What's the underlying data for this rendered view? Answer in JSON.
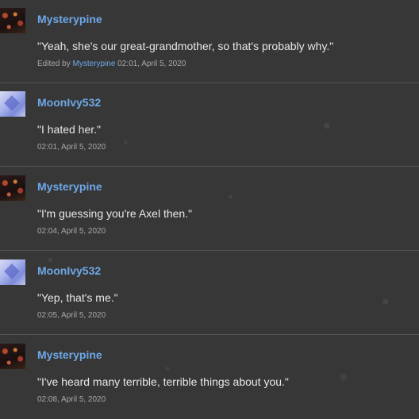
{
  "comments": [
    {
      "author": "Mysterypine",
      "avatar": "mysterypine-avatar",
      "text": "\"Yeah, she's our great-grandmother, so that's probably why.\"",
      "edited_prefix": "Edited by",
      "edited_by": "Mysterypine",
      "timestamp": "02:01, April 5, 2020"
    },
    {
      "author": "MoonIvy532",
      "avatar": "moonivy532-avatar",
      "text": "\"I hated her.\"",
      "timestamp": "02:01, April 5, 2020"
    },
    {
      "author": "Mysterypine",
      "avatar": "mysterypine-avatar",
      "text": "\"I'm guessing you're Axel then.\"",
      "timestamp": "02:04, April 5, 2020"
    },
    {
      "author": "MoonIvy532",
      "avatar": "moonivy532-avatar",
      "text": "\"Yep, that's me.\"",
      "timestamp": "02:05, April 5, 2020"
    },
    {
      "author": "Mysterypine",
      "avatar": "mysterypine-avatar",
      "text": "\"I've heard many terrible, terrible things about you.\"",
      "timestamp": "02:08, April 5, 2020"
    }
  ],
  "colors": {
    "background": "#373737",
    "username": "#6ea8e8",
    "text": "#e8e8e8",
    "meta": "#a8a8a8",
    "divider": "#555555"
  }
}
